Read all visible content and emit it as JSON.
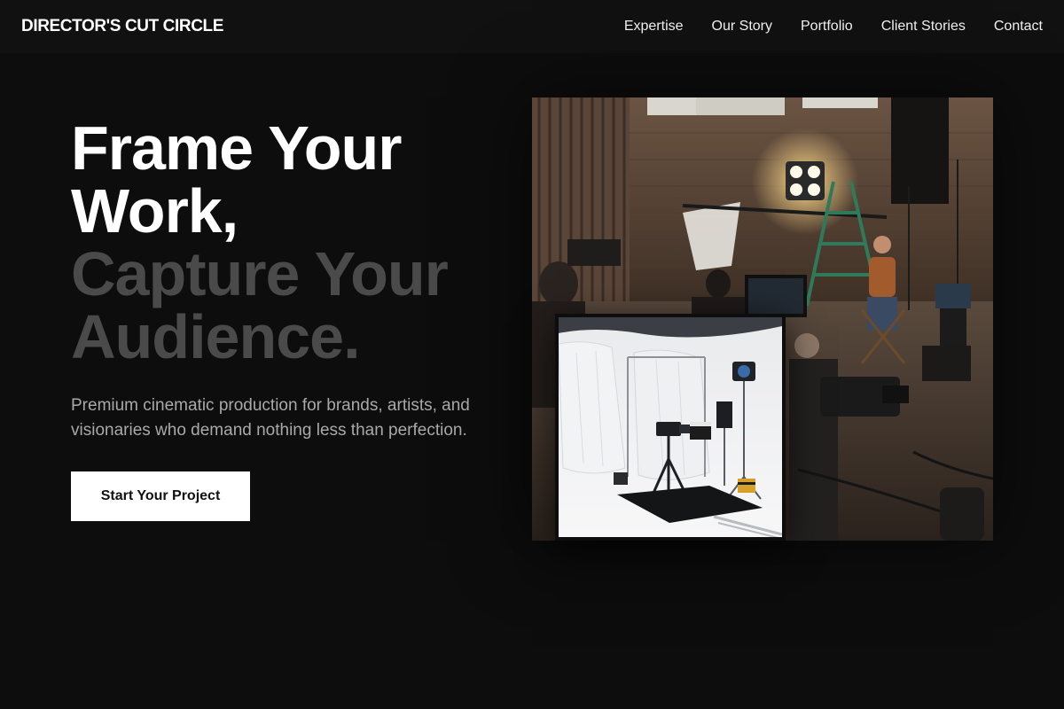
{
  "header": {
    "brand": "DIRECTOR'S CUT CIRCLE",
    "nav": [
      {
        "label": "Expertise"
      },
      {
        "label": "Our Story"
      },
      {
        "label": "Portfolio"
      },
      {
        "label": "Client Stories"
      },
      {
        "label": "Contact"
      }
    ]
  },
  "hero": {
    "headline_line1": "Frame Your",
    "headline_line2": "Work,",
    "headline_line3": "Capture Your",
    "headline_line4": "Audience.",
    "subtitle": "Premium cinematic production for brands, artists, and visionaries who demand nothing less than perfection.",
    "cta_label": "Start Your Project"
  },
  "colors": {
    "background": "#0d0d0d",
    "topbar": "#111111",
    "headline_primary": "#ffffff",
    "headline_dim": "#4a4a4a",
    "subtitle": "#a9a9a9",
    "cta_background": "#ffffff",
    "cta_text": "#111111"
  }
}
